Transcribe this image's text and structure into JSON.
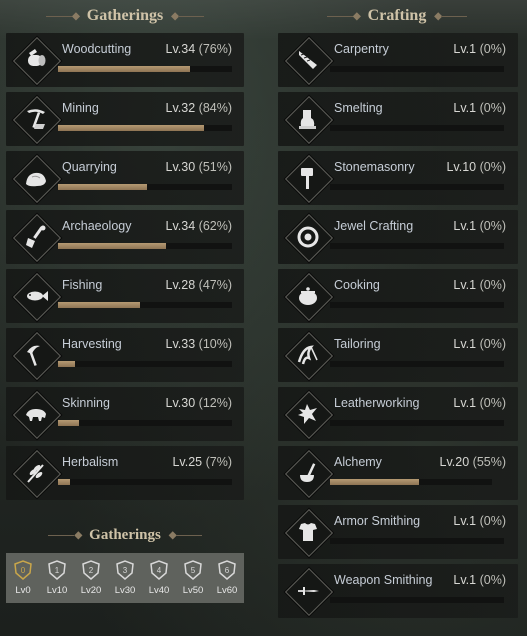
{
  "sections": {
    "gatherings_title": "Gatherings",
    "crafting_title": "Crafting",
    "gatherings_title_2": "Gatherings"
  },
  "gatherings": [
    {
      "name": "Woodcutting",
      "level": "Lv.34",
      "percent": "(76%)",
      "progress": 0.76,
      "icon": "woodcutting-icon"
    },
    {
      "name": "Mining",
      "level": "Lv.32",
      "percent": "(84%)",
      "progress": 0.84,
      "icon": "mining-icon"
    },
    {
      "name": "Quarrying",
      "level": "Lv.30",
      "percent": "(51%)",
      "progress": 0.51,
      "icon": "quarrying-icon"
    },
    {
      "name": "Archaeology",
      "level": "Lv.34",
      "percent": "(62%)",
      "progress": 0.62,
      "icon": "archaeology-icon"
    },
    {
      "name": "Fishing",
      "level": "Lv.28",
      "percent": "(47%)",
      "progress": 0.47,
      "icon": "fishing-icon"
    },
    {
      "name": "Harvesting",
      "level": "Lv.33",
      "percent": "(10%)",
      "progress": 0.1,
      "icon": "harvesting-icon"
    },
    {
      "name": "Skinning",
      "level": "Lv.30",
      "percent": "(12%)",
      "progress": 0.12,
      "icon": "skinning-icon"
    },
    {
      "name": "Herbalism",
      "level": "Lv.25",
      "percent": "(7%)",
      "progress": 0.07,
      "icon": "herbalism-icon"
    }
  ],
  "crafting": [
    {
      "name": "Carpentry",
      "level": "Lv.1",
      "percent": "(0%)",
      "progress": 0,
      "icon": "carpentry-icon"
    },
    {
      "name": "Smelting",
      "level": "Lv.1",
      "percent": "(0%)",
      "progress": 0,
      "icon": "smelting-icon"
    },
    {
      "name": "Stonemasonry",
      "level": "Lv.10",
      "percent": "(0%)",
      "progress": 0,
      "icon": "stonemasonry-icon"
    },
    {
      "name": "Jewel Crafting",
      "level": "Lv.1",
      "percent": "(0%)",
      "progress": 0,
      "icon": "jewel-crafting-icon"
    },
    {
      "name": "Cooking",
      "level": "Lv.1",
      "percent": "(0%)",
      "progress": 0,
      "icon": "cooking-icon"
    },
    {
      "name": "Tailoring",
      "level": "Lv.1",
      "percent": "(0%)",
      "progress": 0,
      "icon": "tailoring-icon"
    },
    {
      "name": "Leatherworking",
      "level": "Lv.1",
      "percent": "(0%)",
      "progress": 0,
      "icon": "leatherworking-icon"
    },
    {
      "name": "Alchemy",
      "level": "Lv.20",
      "percent": "(55%)",
      "progress": 0.55,
      "icon": "alchemy-icon"
    },
    {
      "name": "Armor Smithing",
      "level": "Lv.1",
      "percent": "(0%)",
      "progress": 0,
      "icon": "armor-smithing-icon"
    },
    {
      "name": "Weapon Smithing",
      "level": "Lv.1",
      "percent": "(0%)",
      "progress": 0,
      "icon": "weapon-smithing-icon"
    }
  ],
  "tiers": [
    {
      "label": "Lv0",
      "badge": "0"
    },
    {
      "label": "Lv10",
      "badge": "1"
    },
    {
      "label": "Lv20",
      "badge": "2"
    },
    {
      "label": "Lv30",
      "badge": "3"
    },
    {
      "label": "Lv40",
      "badge": "4"
    },
    {
      "label": "Lv50",
      "badge": "5"
    },
    {
      "label": "Lv60",
      "badge": "6"
    }
  ],
  "colors": {
    "bar_fill": "#a88c66",
    "tier_active": "#c9a64a",
    "tier_inactive": "#d8d8d8"
  }
}
